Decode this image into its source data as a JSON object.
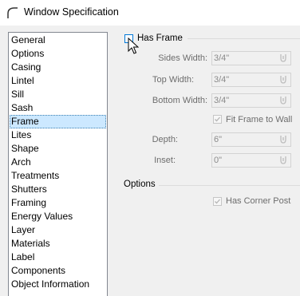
{
  "window": {
    "title": "Window Specification"
  },
  "sidebar": {
    "items": [
      {
        "label": "General"
      },
      {
        "label": "Options"
      },
      {
        "label": "Casing"
      },
      {
        "label": "Lintel"
      },
      {
        "label": "Sill"
      },
      {
        "label": "Sash"
      },
      {
        "label": "Frame"
      },
      {
        "label": "Lites"
      },
      {
        "label": "Shape"
      },
      {
        "label": "Arch"
      },
      {
        "label": "Treatments"
      },
      {
        "label": "Shutters"
      },
      {
        "label": "Framing"
      },
      {
        "label": "Energy Values"
      },
      {
        "label": "Layer"
      },
      {
        "label": "Materials"
      },
      {
        "label": "Label"
      },
      {
        "label": "Components"
      },
      {
        "label": "Object Information"
      }
    ],
    "selected": "Frame"
  },
  "frame": {
    "has_frame_label": "Has Frame",
    "has_frame_checked": false,
    "sides_width": {
      "label": "Sides Width:",
      "value": "3/4\""
    },
    "top_width": {
      "label": "Top Width:",
      "value": "3/4\""
    },
    "bottom_width": {
      "label": "Bottom Width:",
      "value": "3/4\""
    },
    "fit_frame_label": "Fit Frame to Wall",
    "fit_frame_checked": true,
    "depth": {
      "label": "Depth:",
      "value": "6\""
    },
    "inset": {
      "label": "Inset:",
      "value": "0\""
    }
  },
  "options": {
    "section_label": "Options",
    "corner_post_label": "Has Corner Post",
    "corner_post_checked": true
  },
  "icons": {
    "app": "arch-icon",
    "picker": "dimension-picker-icon"
  }
}
